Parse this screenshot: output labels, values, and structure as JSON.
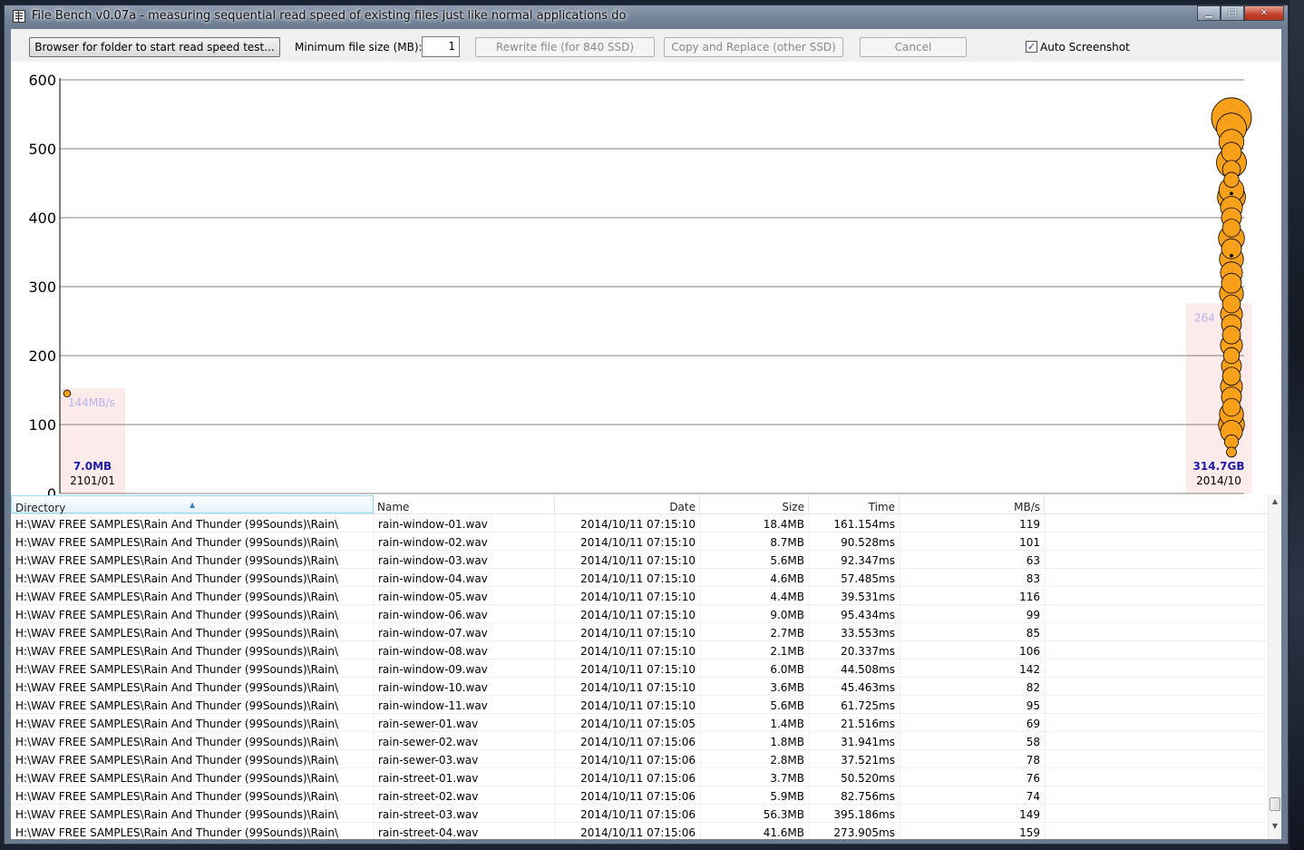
{
  "window": {
    "title": "File Bench v0.07a - measuring sequential read speed of existing files just like normal applications do",
    "controls": [
      "minimize",
      "maximize",
      "close"
    ]
  },
  "toolbar": {
    "browse_label": "Browser for folder to start read speed test...",
    "min_size_label": "Minimum file size (MB):",
    "min_size_value": "1",
    "rewrite_label": "Rewrite file (for 840 SSD)",
    "copy_replace_label": "Copy and Replace (other SSD)",
    "cancel_label": "Cancel",
    "auto_screenshot_label": "Auto Screenshot",
    "auto_screenshot_checked": true
  },
  "chart_data": {
    "type": "scatter",
    "yticks": [
      0,
      100,
      200,
      300,
      400,
      500,
      600
    ],
    "ylim": [
      0,
      600
    ],
    "grid": true,
    "groups": [
      {
        "date_label": "2101/01",
        "size_label": "7.0MB",
        "avg_label": "144MB/s",
        "position": "left",
        "points": [
          {
            "y": 145,
            "size": 7.0
          }
        ]
      },
      {
        "date_label": "2014/10",
        "size_label": "314.7GB",
        "avg_label": "264",
        "position": "right",
        "points": [
          {
            "y": 545,
            "size": 40
          },
          {
            "y": 530,
            "size": 30
          },
          {
            "y": 510,
            "size": 25
          },
          {
            "y": 495,
            "size": 20
          },
          {
            "y": 480,
            "size": 30
          },
          {
            "y": 470,
            "size": 18
          },
          {
            "y": 455,
            "size": 15
          },
          {
            "y": 440,
            "size": 25
          },
          {
            "y": 430,
            "size": 28
          },
          {
            "y": 415,
            "size": 22
          },
          {
            "y": 400,
            "size": 20
          },
          {
            "y": 385,
            "size": 18
          },
          {
            "y": 370,
            "size": 26
          },
          {
            "y": 355,
            "size": 20
          },
          {
            "y": 345,
            "size": 2
          },
          {
            "y": 340,
            "size": 24
          },
          {
            "y": 320,
            "size": 22
          },
          {
            "y": 305,
            "size": 20
          },
          {
            "y": 290,
            "size": 24
          },
          {
            "y": 275,
            "size": 18
          },
          {
            "y": 260,
            "size": 22
          },
          {
            "y": 245,
            "size": 20
          },
          {
            "y": 230,
            "size": 18
          },
          {
            "y": 215,
            "size": 22
          },
          {
            "y": 200,
            "size": 16
          },
          {
            "y": 185,
            "size": 20
          },
          {
            "y": 170,
            "size": 18
          },
          {
            "y": 155,
            "size": 22
          },
          {
            "y": 140,
            "size": 20
          },
          {
            "y": 125,
            "size": 18
          },
          {
            "y": 115,
            "size": 24
          },
          {
            "y": 100,
            "size": 26
          },
          {
            "y": 90,
            "size": 22
          },
          {
            "y": 75,
            "size": 14
          },
          {
            "y": 60,
            "size": 10
          },
          {
            "y": 435,
            "size": 2
          }
        ]
      }
    ]
  },
  "table": {
    "columns": [
      "Directory",
      "Name",
      "Date",
      "Size",
      "Time",
      "MB/s"
    ],
    "sorted_column": "Directory",
    "rows": [
      [
        "H:\\WAV FREE SAMPLES\\Rain And Thunder (99Sounds)\\Rain\\",
        "rain-window-01.wav",
        "2014/10/11 07:15:10",
        "18.4MB",
        "161.154ms",
        "119"
      ],
      [
        "H:\\WAV FREE SAMPLES\\Rain And Thunder (99Sounds)\\Rain\\",
        "rain-window-02.wav",
        "2014/10/11 07:15:10",
        "8.7MB",
        "90.528ms",
        "101"
      ],
      [
        "H:\\WAV FREE SAMPLES\\Rain And Thunder (99Sounds)\\Rain\\",
        "rain-window-03.wav",
        "2014/10/11 07:15:10",
        "5.6MB",
        "92.347ms",
        "63"
      ],
      [
        "H:\\WAV FREE SAMPLES\\Rain And Thunder (99Sounds)\\Rain\\",
        "rain-window-04.wav",
        "2014/10/11 07:15:10",
        "4.6MB",
        "57.485ms",
        "83"
      ],
      [
        "H:\\WAV FREE SAMPLES\\Rain And Thunder (99Sounds)\\Rain\\",
        "rain-window-05.wav",
        "2014/10/11 07:15:10",
        "4.4MB",
        "39.531ms",
        "116"
      ],
      [
        "H:\\WAV FREE SAMPLES\\Rain And Thunder (99Sounds)\\Rain\\",
        "rain-window-06.wav",
        "2014/10/11 07:15:10",
        "9.0MB",
        "95.434ms",
        "99"
      ],
      [
        "H:\\WAV FREE SAMPLES\\Rain And Thunder (99Sounds)\\Rain\\",
        "rain-window-07.wav",
        "2014/10/11 07:15:10",
        "2.7MB",
        "33.553ms",
        "85"
      ],
      [
        "H:\\WAV FREE SAMPLES\\Rain And Thunder (99Sounds)\\Rain\\",
        "rain-window-08.wav",
        "2014/10/11 07:15:10",
        "2.1MB",
        "20.337ms",
        "106"
      ],
      [
        "H:\\WAV FREE SAMPLES\\Rain And Thunder (99Sounds)\\Rain\\",
        "rain-window-09.wav",
        "2014/10/11 07:15:10",
        "6.0MB",
        "44.508ms",
        "142"
      ],
      [
        "H:\\WAV FREE SAMPLES\\Rain And Thunder (99Sounds)\\Rain\\",
        "rain-window-10.wav",
        "2014/10/11 07:15:10",
        "3.6MB",
        "45.463ms",
        "82"
      ],
      [
        "H:\\WAV FREE SAMPLES\\Rain And Thunder (99Sounds)\\Rain\\",
        "rain-window-11.wav",
        "2014/10/11 07:15:10",
        "5.6MB",
        "61.725ms",
        "95"
      ],
      [
        "H:\\WAV FREE SAMPLES\\Rain And Thunder (99Sounds)\\Rain\\",
        "rain-sewer-01.wav",
        "2014/10/11 07:15:05",
        "1.4MB",
        "21.516ms",
        "69"
      ],
      [
        "H:\\WAV FREE SAMPLES\\Rain And Thunder (99Sounds)\\Rain\\",
        "rain-sewer-02.wav",
        "2014/10/11 07:15:06",
        "1.8MB",
        "31.941ms",
        "58"
      ],
      [
        "H:\\WAV FREE SAMPLES\\Rain And Thunder (99Sounds)\\Rain\\",
        "rain-sewer-03.wav",
        "2014/10/11 07:15:06",
        "2.8MB",
        "37.521ms",
        "78"
      ],
      [
        "H:\\WAV FREE SAMPLES\\Rain And Thunder (99Sounds)\\Rain\\",
        "rain-street-01.wav",
        "2014/10/11 07:15:06",
        "3.7MB",
        "50.520ms",
        "76"
      ],
      [
        "H:\\WAV FREE SAMPLES\\Rain And Thunder (99Sounds)\\Rain\\",
        "rain-street-02.wav",
        "2014/10/11 07:15:06",
        "5.9MB",
        "82.756ms",
        "74"
      ],
      [
        "H:\\WAV FREE SAMPLES\\Rain And Thunder (99Sounds)\\Rain\\",
        "rain-street-03.wav",
        "2014/10/11 07:15:06",
        "56.3MB",
        "395.186ms",
        "149"
      ],
      [
        "H:\\WAV FREE SAMPLES\\Rain And Thunder (99Sounds)\\Rain\\",
        "rain-street-04.wav",
        "2014/10/11 07:15:06",
        "41.6MB",
        "273.905ms",
        "159"
      ]
    ]
  },
  "colors": {
    "point_fill": "#f9a01b",
    "point_stroke": "#000000",
    "group_band": "#fdeaea",
    "avg_label": "#b7b4f0",
    "size_label": "#1c1ca8",
    "grid": "#808080"
  }
}
